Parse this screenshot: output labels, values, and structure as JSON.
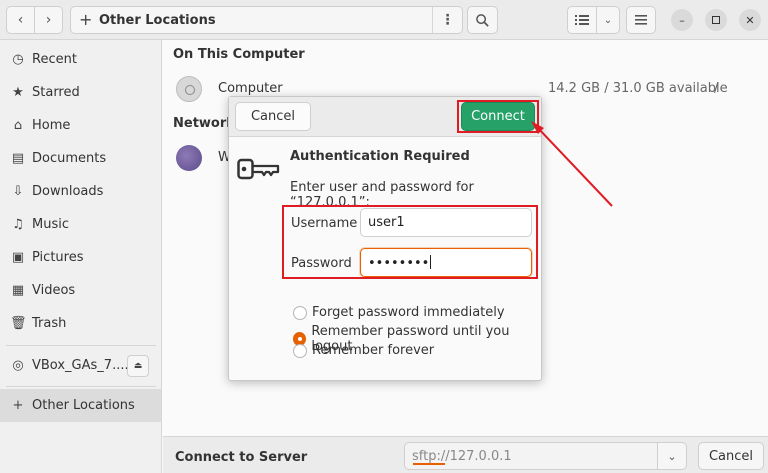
{
  "header": {
    "location": "Other Locations",
    "back_icon": "chevron-left-icon",
    "forward_icon": "chevron-right-icon"
  },
  "sidebar": {
    "items": [
      {
        "label": "Recent",
        "icon": "clock-icon"
      },
      {
        "label": "Starred",
        "icon": "star-icon"
      },
      {
        "label": "Home",
        "icon": "home-icon"
      },
      {
        "label": "Documents",
        "icon": "document-icon"
      },
      {
        "label": "Downloads",
        "icon": "download-icon"
      },
      {
        "label": "Music",
        "icon": "music-icon"
      },
      {
        "label": "Pictures",
        "icon": "picture-icon"
      },
      {
        "label": "Videos",
        "icon": "video-icon"
      },
      {
        "label": "Trash",
        "icon": "trash-icon"
      }
    ],
    "device": "VBox_GAs_7....",
    "other_locations": "Other Locations"
  },
  "main": {
    "on_this_computer": "On This Computer",
    "computer_label": "Computer",
    "computer_usage": "14.2 GB / 31.0 GB available",
    "computer_mount": "/",
    "networks_header": "Network",
    "network_item": "W"
  },
  "bottom": {
    "connect_label": "Connect to Server",
    "server_value": "sftp://127.0.0.1",
    "cancel_label": "Cancel"
  },
  "dialog": {
    "cancel": "Cancel",
    "connect": "Connect",
    "title": "Authentication Required",
    "message": "Enter user and password for “127.0.0.1”:",
    "username_label": "Username",
    "username_value": "user1",
    "password_label": "Password",
    "password_mask": "••••••••",
    "options": [
      {
        "label": "Forget password immediately",
        "selected": false
      },
      {
        "label": "Remember password until you logout",
        "selected": true
      },
      {
        "label": "Remember forever",
        "selected": false
      }
    ]
  },
  "colors": {
    "accent": "#e66100",
    "connect_green": "#26a269",
    "annotation_red": "#e01b24"
  }
}
